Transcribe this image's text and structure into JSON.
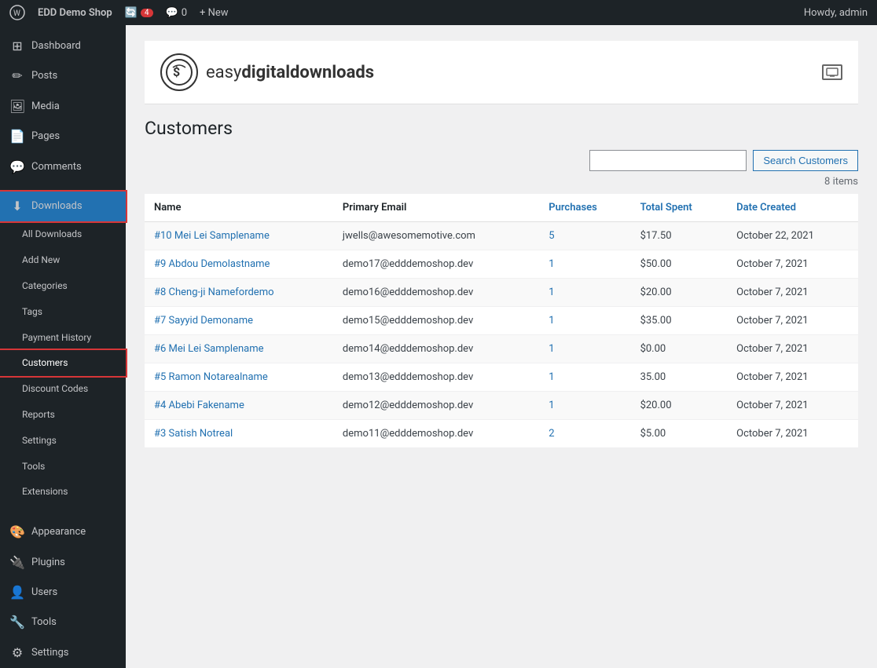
{
  "adminbar": {
    "logo_label": "WordPress",
    "site_name": "EDD Demo Shop",
    "updates_count": "4",
    "comments_count": "0",
    "new_label": "+ New",
    "howdy": "Howdy, admin"
  },
  "sidebar": {
    "items": [
      {
        "id": "dashboard",
        "label": "Dashboard",
        "icon": "⊞",
        "active": false
      },
      {
        "id": "posts",
        "label": "Posts",
        "icon": "📝",
        "active": false
      },
      {
        "id": "media",
        "label": "Media",
        "icon": "🖼",
        "active": false
      },
      {
        "id": "pages",
        "label": "Pages",
        "icon": "📄",
        "active": false
      },
      {
        "id": "comments",
        "label": "Comments",
        "icon": "💬",
        "active": false
      },
      {
        "id": "downloads",
        "label": "Downloads",
        "icon": "⬇",
        "active": true,
        "highlighted": true
      }
    ],
    "submenu": [
      {
        "id": "all-downloads",
        "label": "All Downloads"
      },
      {
        "id": "add-new",
        "label": "Add New"
      },
      {
        "id": "categories",
        "label": "Categories"
      },
      {
        "id": "tags",
        "label": "Tags"
      },
      {
        "id": "payment-history",
        "label": "Payment History"
      },
      {
        "id": "customers",
        "label": "Customers",
        "active": true
      },
      {
        "id": "discount-codes",
        "label": "Discount Codes"
      },
      {
        "id": "reports",
        "label": "Reports"
      },
      {
        "id": "settings",
        "label": "Settings"
      },
      {
        "id": "tools",
        "label": "Tools"
      },
      {
        "id": "extensions",
        "label": "Extensions"
      }
    ],
    "bottom_items": [
      {
        "id": "appearance",
        "label": "Appearance",
        "icon": "🎨"
      },
      {
        "id": "plugins",
        "label": "Plugins",
        "icon": "🔌"
      },
      {
        "id": "users",
        "label": "Users",
        "icon": "👤"
      },
      {
        "id": "tools",
        "label": "Tools",
        "icon": "🔧"
      },
      {
        "id": "settings",
        "label": "Settings",
        "icon": "⚙"
      }
    ]
  },
  "plugin_header": {
    "logo_icon": "💲",
    "logo_text_plain": "easy",
    "logo_text_bold": "digitaldownloads",
    "screen_icon": "⬜"
  },
  "page": {
    "title": "Customers",
    "items_count": "8 items",
    "search_placeholder": "",
    "search_button_label": "Search Customers"
  },
  "table": {
    "columns": [
      {
        "id": "name",
        "label": "Name",
        "sortable": false
      },
      {
        "id": "email",
        "label": "Primary Email",
        "sortable": false
      },
      {
        "id": "purchases",
        "label": "Purchases",
        "sortable": true
      },
      {
        "id": "total_spent",
        "label": "Total Spent",
        "sortable": true
      },
      {
        "id": "date_created",
        "label": "Date Created",
        "sortable": true
      }
    ],
    "rows": [
      {
        "id": 10,
        "name": "#10 Mei Lei Samplename",
        "email": "jwells@awesomemotive.com",
        "purchases": "5",
        "total_spent": "$17.50",
        "date_created": "October 22, 2021"
      },
      {
        "id": 9,
        "name": "#9 Abdou Demolastname",
        "email": "demo17@edddemoshop.dev",
        "purchases": "1",
        "total_spent": "$50.00",
        "date_created": "October 7, 2021"
      },
      {
        "id": 8,
        "name": "#8 Cheng-ji Namefordemo",
        "email": "demo16@edddemoshop.dev",
        "purchases": "1",
        "total_spent": "$20.00",
        "date_created": "October 7, 2021"
      },
      {
        "id": 7,
        "name": "#7 Sayyid Demoname",
        "email": "demo15@edddemoshop.dev",
        "purchases": "1",
        "total_spent": "$35.00",
        "date_created": "October 7, 2021"
      },
      {
        "id": 6,
        "name": "#6 Mei Lei Samplename",
        "email": "demo14@edddemoshop.dev",
        "purchases": "1",
        "total_spent": "$0.00",
        "date_created": "October 7, 2021"
      },
      {
        "id": 5,
        "name": "#5 Ramon Notarealname",
        "email": "demo13@edddemoshop.dev",
        "purchases": "1",
        "total_spent": "35.00",
        "date_created": "October 7, 2021"
      },
      {
        "id": 4,
        "name": "#4 Abebi Fakename",
        "email": "demo12@edddemoshop.dev",
        "purchases": "1",
        "total_spent": "$20.00",
        "date_created": "October 7, 2021"
      },
      {
        "id": 3,
        "name": "#3 Satish Notreal",
        "email": "demo11@edddemoshop.dev",
        "purchases": "2",
        "total_spent": "$5.00",
        "date_created": "October 7, 2021"
      }
    ]
  }
}
